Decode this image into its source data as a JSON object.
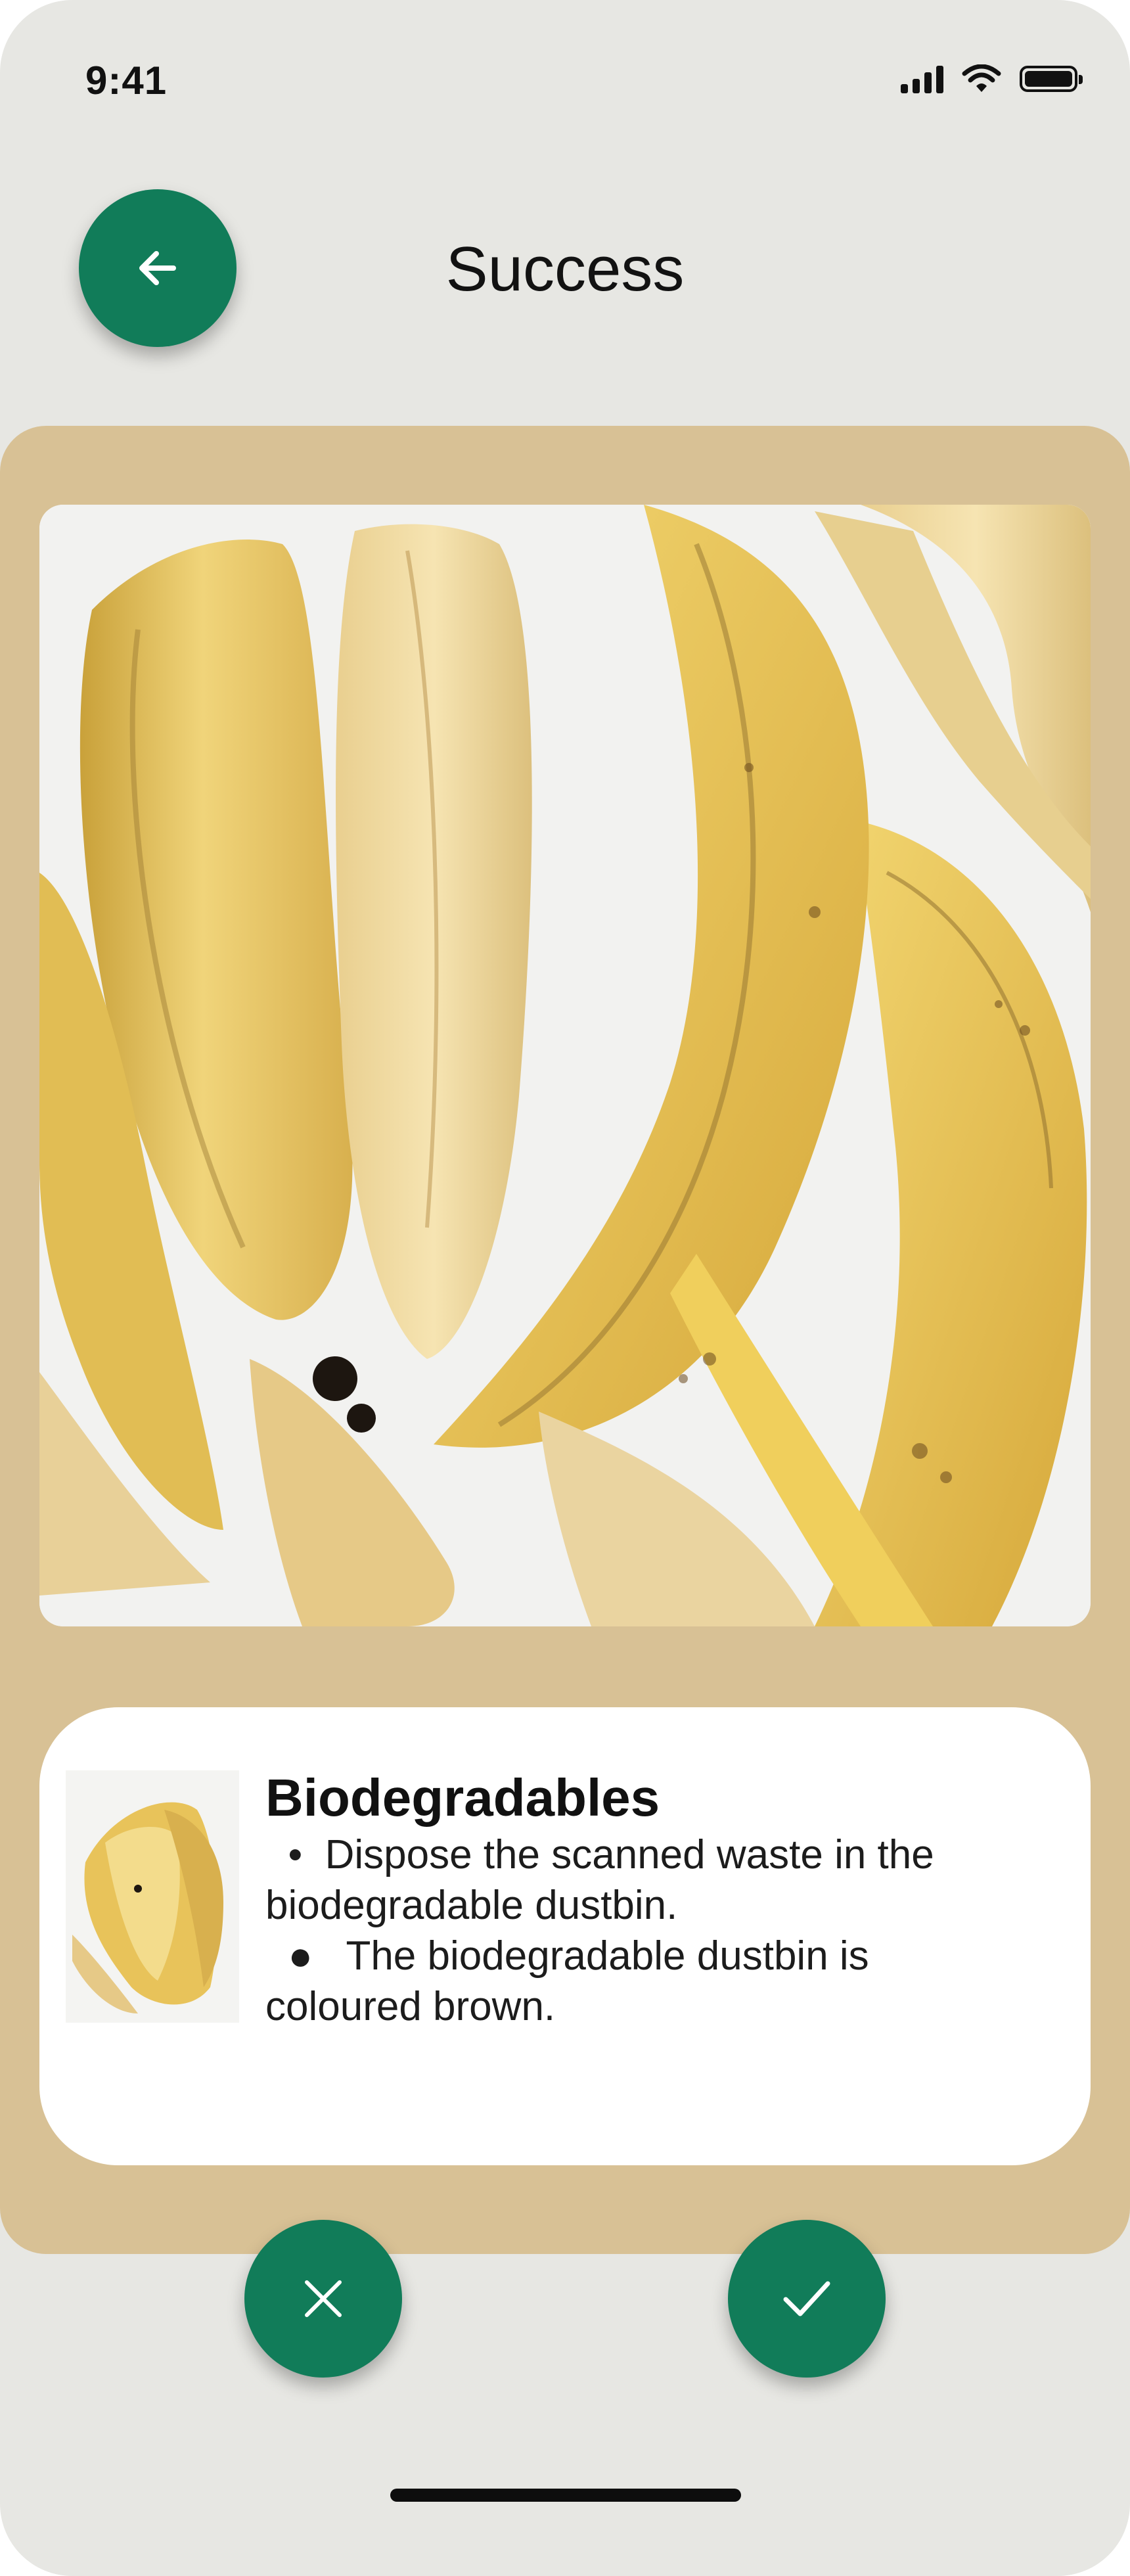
{
  "status_bar": {
    "time": "9:41",
    "icons": [
      "signal-icon",
      "wifi-icon",
      "battery-icon"
    ]
  },
  "header": {
    "title": "Success",
    "back_icon": "arrow-left-icon"
  },
  "scan": {
    "image": "banana-peels-photo"
  },
  "result": {
    "thumbnail": "banana-peels-thumbnail",
    "category": "Biodegradables",
    "line1": "  •  Dispose the scanned waste in the",
    "line2": "biodegradable dustbin.",
    "line3": "  ●   The biodegradable dustbin is",
    "line4": "coloured brown."
  },
  "actions": {
    "cancel_icon": "close-icon",
    "confirm_icon": "check-icon"
  },
  "colors": {
    "accent": "#117c59",
    "panel": "#d8c195",
    "background": "#e7e7e3",
    "card": "#ffffff"
  }
}
